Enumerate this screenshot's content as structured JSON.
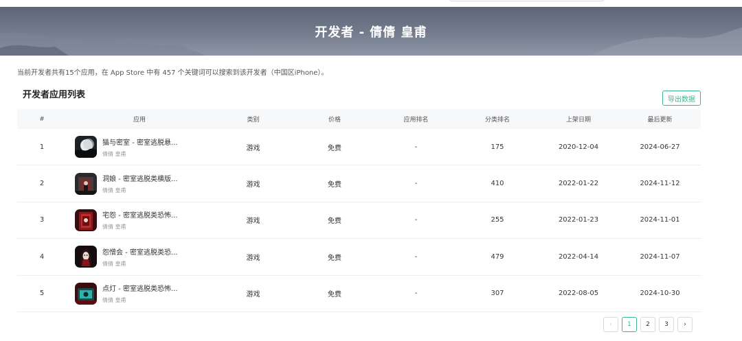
{
  "header": {
    "title": "开发者 - 倩倩 皇甫",
    "top_links": [
      "",
      ""
    ]
  },
  "summary": "当前开发者共有15个应用，在 App Store 中有 457 个关键词可以搜索到该开发者（中国区iPhone）。",
  "section_title": "开发者应用列表",
  "export_label": "导出数据",
  "table": {
    "headers": [
      "#",
      "应用",
      "类别",
      "价格",
      "应用排名",
      "分类排名",
      "上架日期",
      "最后更新"
    ],
    "rows": [
      {
        "index": "1",
        "name": "猫与密室 - 密室逃脱悬...",
        "developer": "倩倩 皇甫",
        "category": "游戏",
        "price": "免费",
        "app_rank": "-",
        "category_rank": "175",
        "release_date": "2020-12-04",
        "last_update": "2024-06-27",
        "icon": "moon-night-icon"
      },
      {
        "index": "2",
        "name": "洞娘 - 密室逃脱类横版...",
        "developer": "倩倩 皇甫",
        "category": "游戏",
        "price": "免费",
        "app_rank": "-",
        "category_rank": "410",
        "release_date": "2022-01-22",
        "last_update": "2024-11-12",
        "icon": "dark-room-icon"
      },
      {
        "index": "3",
        "name": "宅怨 - 密室逃脱类恐怖...",
        "developer": "倩倩 皇甫",
        "category": "游戏",
        "price": "免费",
        "app_rank": "-",
        "category_rank": "255",
        "release_date": "2022-01-23",
        "last_update": "2024-11-01",
        "icon": "red-door-icon"
      },
      {
        "index": "4",
        "name": "怨憎会 - 密室逃脱类恐...",
        "developer": "倩倩 皇甫",
        "category": "游戏",
        "price": "免费",
        "app_rank": "-",
        "category_rank": "479",
        "release_date": "2022-04-14",
        "last_update": "2024-11-07",
        "icon": "ghost-girl-icon"
      },
      {
        "index": "5",
        "name": "点灯 - 密室逃脱类恐怖...",
        "developer": "倩倩 皇甫",
        "category": "游戏",
        "price": "免费",
        "app_rank": "-",
        "category_rank": "307",
        "release_date": "2022-08-05",
        "last_update": "2024-10-30",
        "icon": "green-lamp-icon"
      }
    ]
  },
  "pagination": {
    "prev": "‹",
    "pages": [
      "1",
      "2",
      "3"
    ],
    "current": "1",
    "next": "›"
  },
  "colors": {
    "accent": "#3bb68f",
    "banner": "#6f7889"
  }
}
